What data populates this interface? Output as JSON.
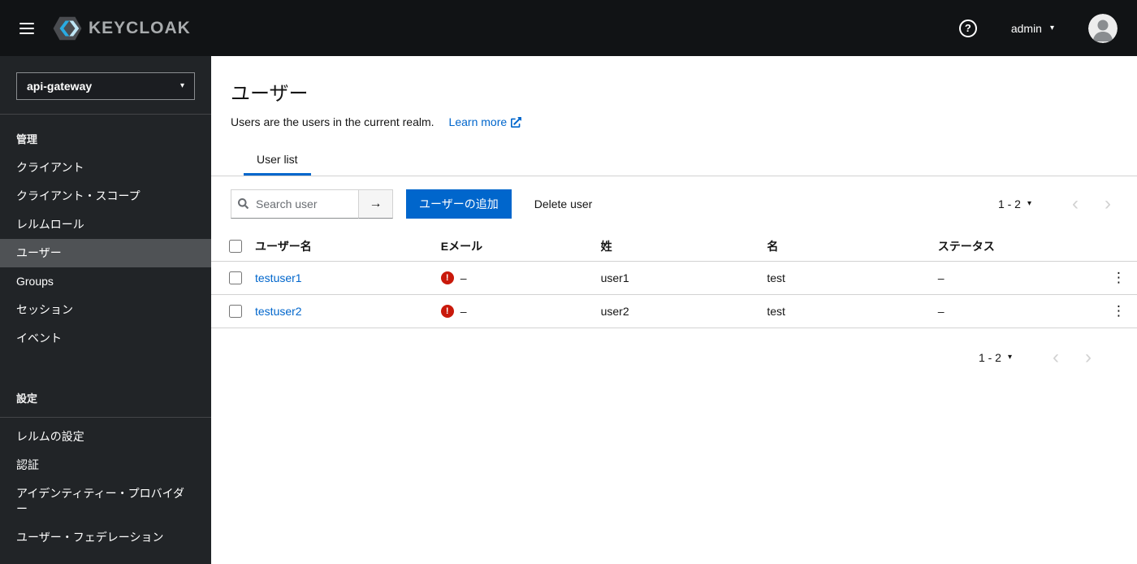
{
  "colors": {
    "accent": "#0066cc",
    "error": "#c9190b",
    "topbar_bg": "#111315",
    "sidebar_bg": "#212427",
    "active_nav_bg": "#4f5255"
  },
  "icons": {
    "caret_down": "▾",
    "arrow_right": "→",
    "chevron_left": "‹",
    "chevron_right": "›",
    "kebab": "⋮",
    "error_mark": "!",
    "help_mark": "?"
  },
  "topbar": {
    "brand": "KEYCLOAK",
    "username": "admin"
  },
  "sidebar": {
    "realm": "api-gateway",
    "section1": {
      "header": "管理",
      "items": [
        "クライアント",
        "クライアント・スコープ",
        "レルムロール",
        "ユーザー",
        "Groups",
        "セッション",
        "イベント"
      ]
    },
    "section2": {
      "header": "設定",
      "items": [
        "レルムの設定",
        "認証",
        "アイデンティティー・プロバイダー",
        "ユーザー・フェデレーション"
      ]
    }
  },
  "page": {
    "title": "ユーザー",
    "description": "Users are the users in the current realm.",
    "learn_more": "Learn more",
    "tab_user_list": "User list"
  },
  "toolbar": {
    "search_placeholder": "Search user",
    "add_user": "ユーザーの追加",
    "delete_user": "Delete user"
  },
  "pagination": {
    "range": "1 - 2"
  },
  "table": {
    "headers": [
      "ユーザー名",
      "Eメール",
      "姓",
      "名",
      "ステータス"
    ],
    "rows": [
      {
        "username": "testuser1",
        "email": "–",
        "lastname": "user1",
        "firstname": "test",
        "status": "–"
      },
      {
        "username": "testuser2",
        "email": "–",
        "lastname": "user2",
        "firstname": "test",
        "status": "–"
      }
    ]
  }
}
